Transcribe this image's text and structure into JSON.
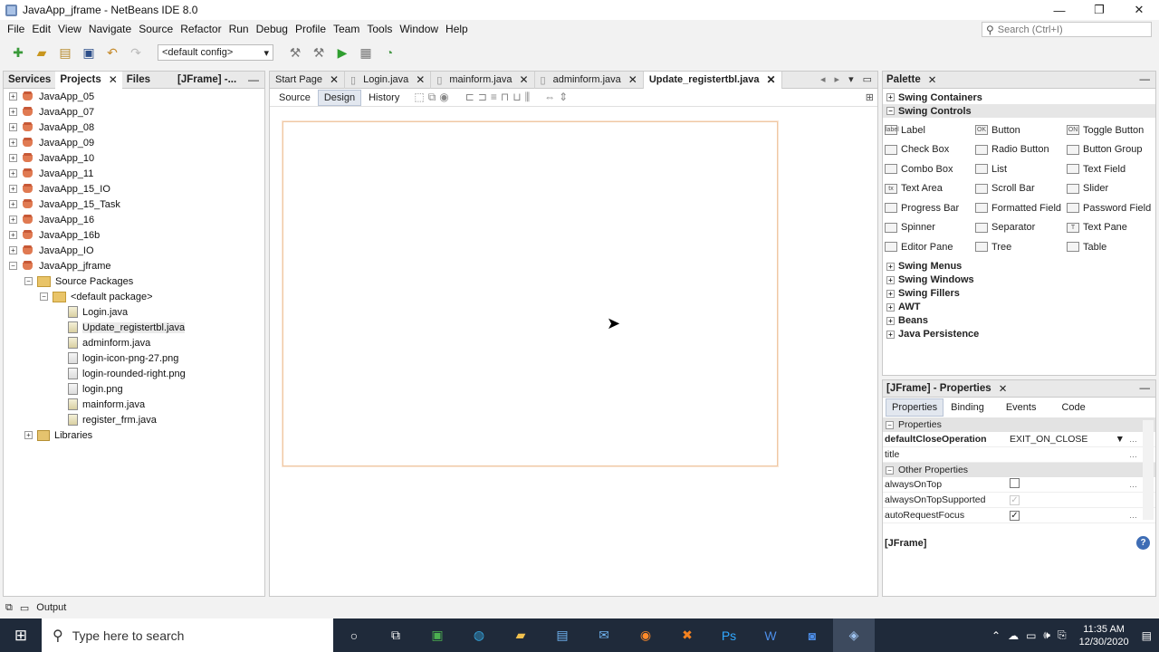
{
  "window": {
    "title": "JavaApp_jframe - NetBeans IDE 8.0",
    "controls": {
      "minimize": "—",
      "restore": "❐",
      "close": "✕"
    }
  },
  "menu": [
    "File",
    "Edit",
    "View",
    "Navigate",
    "Source",
    "Refactor",
    "Run",
    "Debug",
    "Profile",
    "Team",
    "Tools",
    "Window",
    "Help"
  ],
  "search": {
    "placeholder": "Search (Ctrl+I)"
  },
  "toolbar": {
    "config": "<default config>"
  },
  "left_panel": {
    "tabs": [
      {
        "label": "Services",
        "close": ""
      },
      {
        "label": "Projects",
        "close": "✕"
      },
      {
        "label": "Files",
        "close": ""
      },
      {
        "label": "[JFrame] -...",
        "close": ""
      }
    ],
    "minimize": "—",
    "tree": [
      {
        "label": "JavaApp_05",
        "kind": "project",
        "depth": 0,
        "exp": "+"
      },
      {
        "label": "JavaApp_07",
        "kind": "project",
        "depth": 0,
        "exp": "+"
      },
      {
        "label": "JavaApp_08",
        "kind": "project",
        "depth": 0,
        "exp": "+"
      },
      {
        "label": "JavaApp_09",
        "kind": "project",
        "depth": 0,
        "exp": "+"
      },
      {
        "label": "JavaApp_10",
        "kind": "project",
        "depth": 0,
        "exp": "+"
      },
      {
        "label": "JavaApp_11",
        "kind": "project",
        "depth": 0,
        "exp": "+"
      },
      {
        "label": "JavaApp_15_IO",
        "kind": "project",
        "depth": 0,
        "exp": "+"
      },
      {
        "label": "JavaApp_15_Task",
        "kind": "project",
        "depth": 0,
        "exp": "+"
      },
      {
        "label": "JavaApp_16",
        "kind": "project",
        "depth": 0,
        "exp": "+"
      },
      {
        "label": "JavaApp_16b",
        "kind": "project",
        "depth": 0,
        "exp": "+"
      },
      {
        "label": "JavaApp_IO",
        "kind": "project",
        "depth": 0,
        "exp": "+"
      },
      {
        "label": "JavaApp_jframe",
        "kind": "project",
        "depth": 0,
        "exp": "−"
      },
      {
        "label": "Source Packages",
        "kind": "package",
        "depth": 1,
        "exp": "−"
      },
      {
        "label": "<default package>",
        "kind": "package",
        "depth": 2,
        "exp": "−"
      },
      {
        "label": "Login.java",
        "kind": "java",
        "depth": 3,
        "exp": ""
      },
      {
        "label": "Update_registertbl.java",
        "kind": "java",
        "depth": 3,
        "exp": "",
        "selected": true
      },
      {
        "label": "adminform.java",
        "kind": "java",
        "depth": 3,
        "exp": ""
      },
      {
        "label": "login-icon-png-27.png",
        "kind": "file",
        "depth": 3,
        "exp": ""
      },
      {
        "label": "login-rounded-right.png",
        "kind": "file",
        "depth": 3,
        "exp": ""
      },
      {
        "label": "login.png",
        "kind": "file",
        "depth": 3,
        "exp": ""
      },
      {
        "label": "mainform.java",
        "kind": "java",
        "depth": 3,
        "exp": ""
      },
      {
        "label": "register_frm.java",
        "kind": "java",
        "depth": 3,
        "exp": ""
      },
      {
        "label": "Libraries",
        "kind": "library",
        "depth": 1,
        "exp": "+"
      }
    ]
  },
  "editor": {
    "tabs": [
      {
        "label": "Start Page",
        "close": "✕"
      },
      {
        "label": "Login.java",
        "close": "✕"
      },
      {
        "label": "mainform.java",
        "close": "✕"
      },
      {
        "label": "adminform.java",
        "close": "✕"
      },
      {
        "label": "Update_registertbl.java",
        "close": "✕",
        "active": true
      }
    ],
    "modes": [
      "Source",
      "Design",
      "History"
    ],
    "active_mode": "Design"
  },
  "palette": {
    "title": "Palette",
    "close": "✕",
    "minimize": "—",
    "categories_top": [
      {
        "label": "Swing Containers",
        "exp": "+"
      },
      {
        "label": "Swing Controls",
        "exp": "−"
      }
    ],
    "items": [
      {
        "label": "Label",
        "icon": "label"
      },
      {
        "label": "Button",
        "icon": "OK"
      },
      {
        "label": "Toggle Button",
        "icon": "ON"
      },
      {
        "label": "Check Box",
        "icon": ""
      },
      {
        "label": "Radio Button",
        "icon": ""
      },
      {
        "label": "Button Group",
        "icon": ""
      },
      {
        "label": "Combo Box",
        "icon": ""
      },
      {
        "label": "List",
        "icon": ""
      },
      {
        "label": "Text Field",
        "icon": ""
      },
      {
        "label": "Text Area",
        "icon": "tx"
      },
      {
        "label": "Scroll Bar",
        "icon": ""
      },
      {
        "label": "Slider",
        "icon": ""
      },
      {
        "label": "Progress Bar",
        "icon": ""
      },
      {
        "label": "Formatted Field",
        "icon": ""
      },
      {
        "label": "Password Field",
        "icon": ""
      },
      {
        "label": "Spinner",
        "icon": ""
      },
      {
        "label": "Separator",
        "icon": ""
      },
      {
        "label": "Text Pane",
        "icon": "T"
      },
      {
        "label": "Editor Pane",
        "icon": ""
      },
      {
        "label": "Tree",
        "icon": ""
      },
      {
        "label": "Table",
        "icon": ""
      }
    ],
    "categories_bottom": [
      {
        "label": "Swing Menus",
        "exp": "+"
      },
      {
        "label": "Swing Windows",
        "exp": "+"
      },
      {
        "label": "Swing Fillers",
        "exp": "+"
      },
      {
        "label": "AWT",
        "exp": "+"
      },
      {
        "label": "Beans",
        "exp": "+"
      },
      {
        "label": "Java Persistence",
        "exp": "+"
      }
    ]
  },
  "properties": {
    "title": "[JFrame] - Properties",
    "close": "✕",
    "minimize": "—",
    "tabs": [
      "Properties",
      "Binding",
      "Events",
      "Code"
    ],
    "section1": "Properties",
    "rows1": [
      {
        "name": "defaultCloseOperation",
        "value": "EXIT_ON_CLOSE",
        "bold": true
      },
      {
        "name": "title",
        "value": ""
      }
    ],
    "section2": "Other Properties",
    "rows2": [
      {
        "name": "alwaysOnTop",
        "check": ""
      },
      {
        "name": "alwaysOnTopSupported",
        "check": "✓",
        "disabled": true
      },
      {
        "name": "autoRequestFocus",
        "check": "✓"
      }
    ],
    "footer": "[JFrame]",
    "help": "?"
  },
  "output": {
    "label": "Output"
  },
  "taskbar": {
    "search_placeholder": "Type here to search",
    "time": "11:35 AM",
    "date": "12/30/2020"
  }
}
